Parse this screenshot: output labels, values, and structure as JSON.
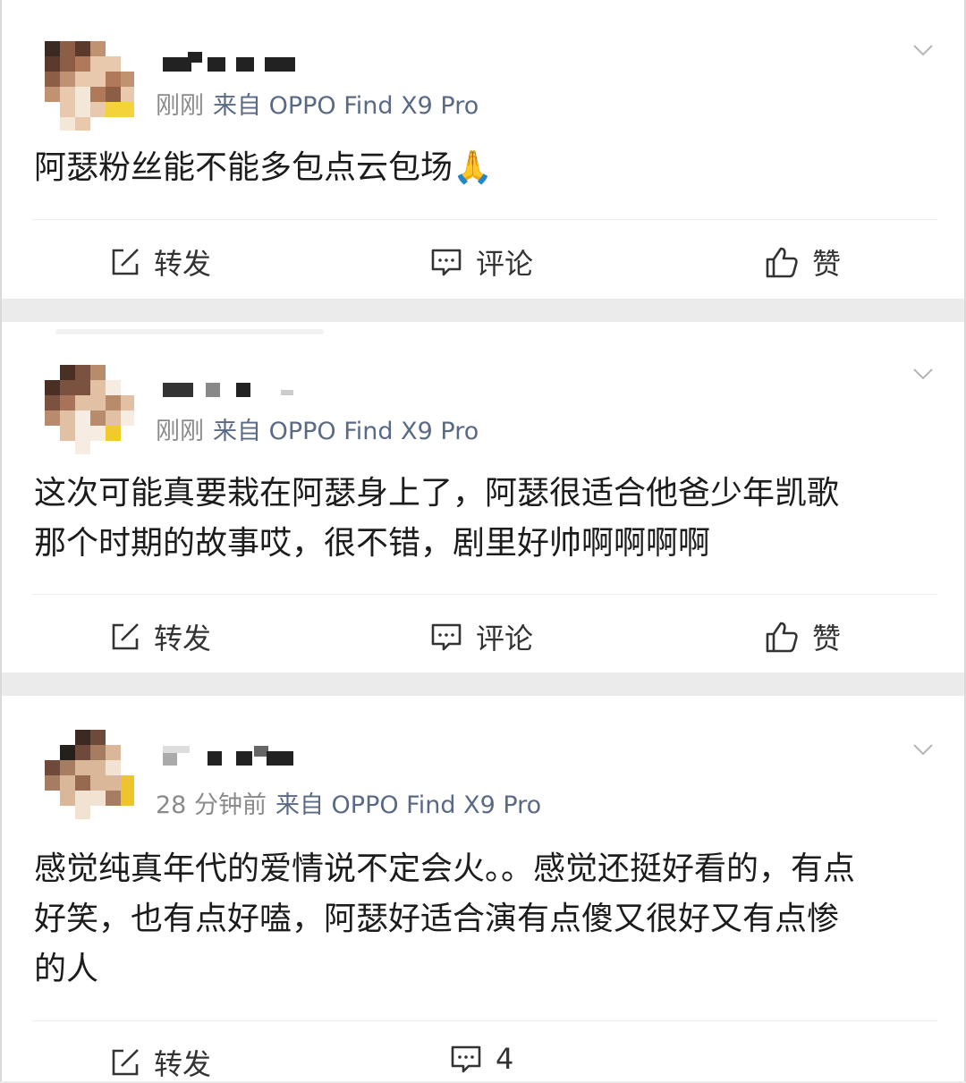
{
  "posts": [
    {
      "time": "刚刚",
      "source": "来自 OPPO Find X9 Pro",
      "text": "阿瑟粉丝能不能多包点云包场🙏",
      "actions": {
        "repost": "转发",
        "comment": "评论",
        "like": "赞"
      }
    },
    {
      "time": "刚刚",
      "source": "来自 OPPO Find X9 Pro",
      "text_lines": [
        "这次可能真要栽在阿瑟身上了，阿瑟很适合他爸少年凯歌",
        "那个时期的故事哎，很不错，剧里好帅啊啊啊啊"
      ],
      "actions": {
        "repost": "转发",
        "comment": "评论",
        "like": "赞"
      }
    },
    {
      "time": "28 分钟前",
      "source": "来自 OPPO Find X9 Pro",
      "text_lines": [
        "感觉纯真年代的爱情说不定会火。。感觉还挺好看的，有点",
        "好笑，也有点好嗑，阿瑟好适合演有点傻又很好又有点惨",
        "的人"
      ],
      "actions": {
        "repost": "转发",
        "comment_count": "4"
      }
    }
  ],
  "icons": [
    "repost-icon",
    "comment-icon",
    "like-icon",
    "chevron-down-icon"
  ]
}
